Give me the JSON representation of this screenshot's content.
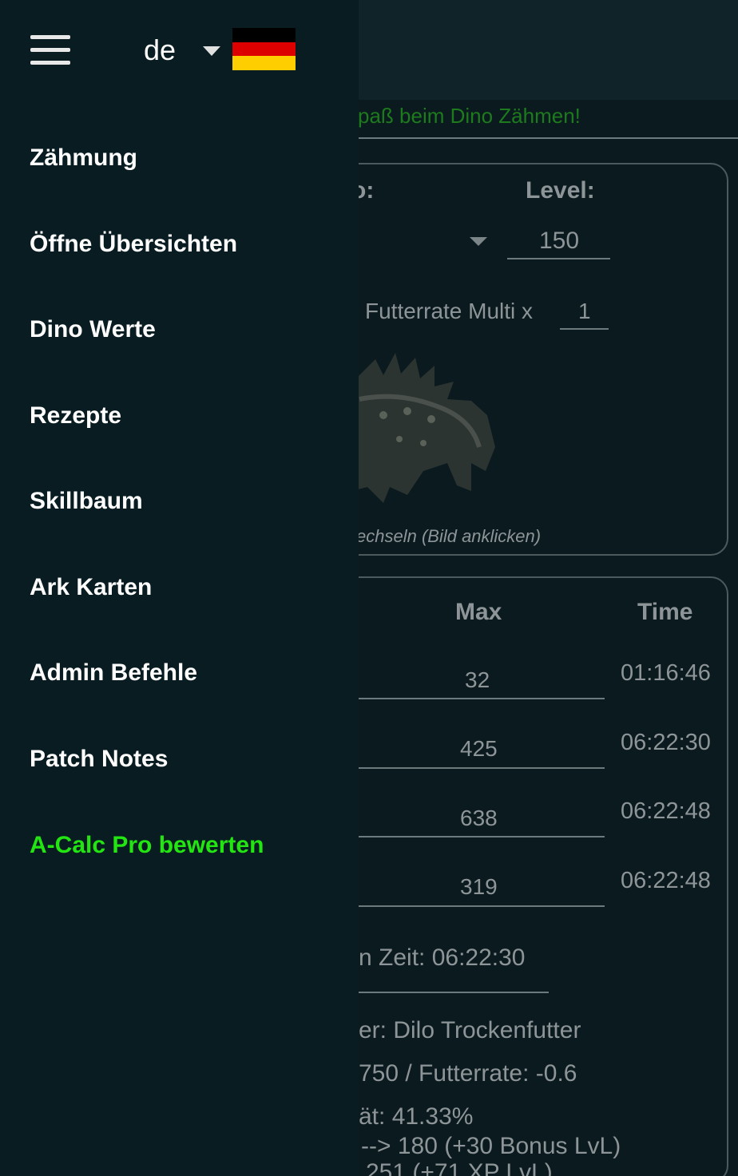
{
  "header": {
    "language": "de",
    "flag_colors": [
      "#000000",
      "#dd0000",
      "#ffce00"
    ]
  },
  "drawer": {
    "items": [
      {
        "label": "Zähmung"
      },
      {
        "label": "Öffne Übersichten"
      },
      {
        "label": "Dino Werte"
      },
      {
        "label": "Rezepte"
      },
      {
        "label": "Skillbaum"
      },
      {
        "label": "Ark Karten"
      },
      {
        "label": "Admin Befehle"
      },
      {
        "label": "Patch Notes"
      },
      {
        "label": "A-Calc Pro bewerten",
        "accent": "#22e512"
      }
    ]
  },
  "background": {
    "welcome": "paß beim Dino Zähmen!",
    "dino_label": "o:",
    "level_label": "Level:",
    "level_value": "150",
    "food_rate_label": "Futterrate Multi x",
    "food_rate_value": "1",
    "image_hint": "echseln (Bild anklicken)",
    "table": {
      "col_max": "Max",
      "col_time": "Time",
      "rows": [
        {
          "max": "32",
          "time": "01:16:46"
        },
        {
          "max": "425",
          "time": "06:22:30"
        },
        {
          "max": "638",
          "time": "06:22:48"
        },
        {
          "max": "319",
          "time": "06:22:48"
        }
      ]
    },
    "time_summary": "n Zeit: 06:22:30",
    "food": "er: Dilo Trockenfutter",
    "food_value": "750 / Futterrate: -0.6",
    "effectiveness": "ät: 41.33%",
    "level_result": "--> 180 (+30 Bonus LvL)",
    "xp_result": "251 (+71 XP LvL)"
  }
}
